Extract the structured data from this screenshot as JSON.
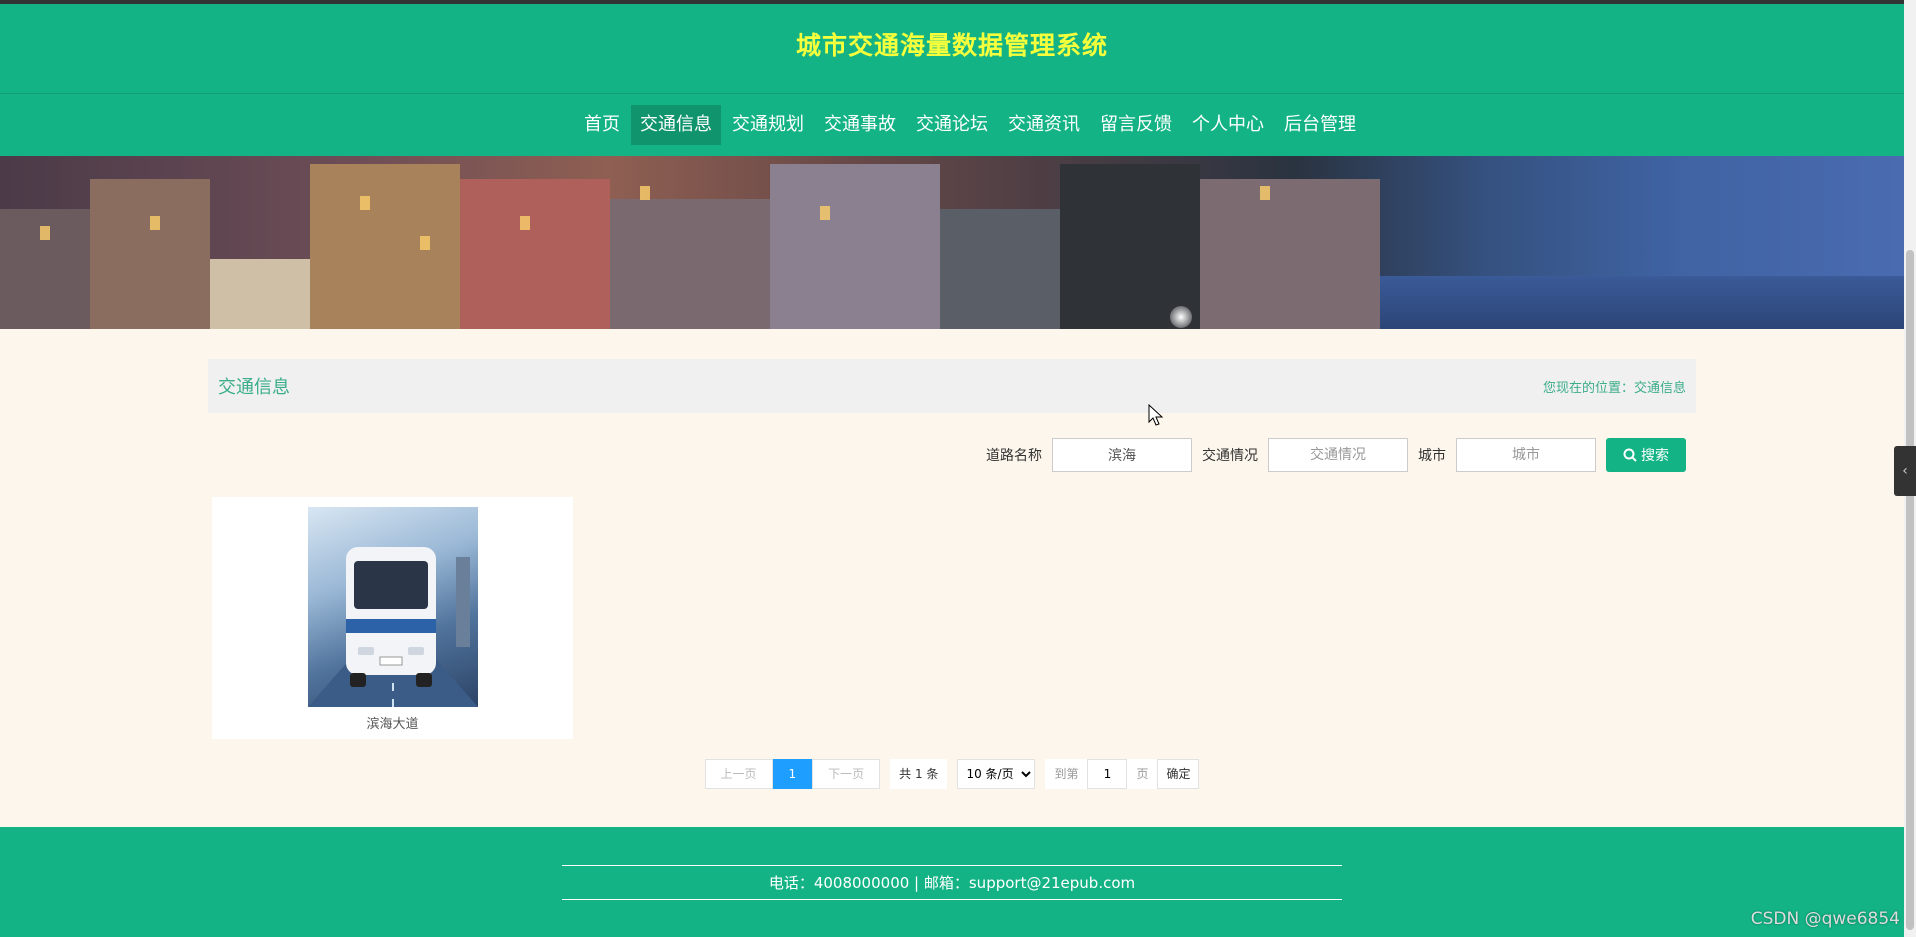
{
  "site": {
    "title": "城市交通海量数据管理系统"
  },
  "nav": {
    "items": [
      {
        "label": "首页",
        "active": false
      },
      {
        "label": "交通信息",
        "active": true
      },
      {
        "label": "交通规划",
        "active": false
      },
      {
        "label": "交通事故",
        "active": false
      },
      {
        "label": "交通论坛",
        "active": false
      },
      {
        "label": "交通资讯",
        "active": false
      },
      {
        "label": "留言反馈",
        "active": false
      },
      {
        "label": "个人中心",
        "active": false
      },
      {
        "label": "后台管理",
        "active": false
      }
    ]
  },
  "section": {
    "title": "交通信息",
    "location": "您现在的位置：交通信息"
  },
  "search": {
    "road_label": "道路名称",
    "road_value": "滨海",
    "traffic_label": "交通情况",
    "traffic_placeholder": "交通情况",
    "city_label": "城市",
    "city_placeholder": "城市",
    "button_label": "搜索"
  },
  "cards": [
    {
      "caption": "滨海大道",
      "icon": "bus-image"
    }
  ],
  "pagination": {
    "prev": "上一页",
    "current": "1",
    "next": "下一页",
    "total": "共 1 条",
    "page_size_options": [
      "10 条/页"
    ],
    "goto_label": "到第",
    "goto_value": "1",
    "page_unit": "页",
    "confirm": "确定"
  },
  "footer": {
    "text": "电话：4008000000 | 邮箱：support@21epub.com"
  },
  "watermark": "CSDN @qwe6854",
  "colors": {
    "primary": "#13b385",
    "title": "#f5ff3c",
    "page_bg": "#fdf6ec",
    "accent_text": "#3bad8a",
    "pagination_current": "#1e9fff"
  }
}
